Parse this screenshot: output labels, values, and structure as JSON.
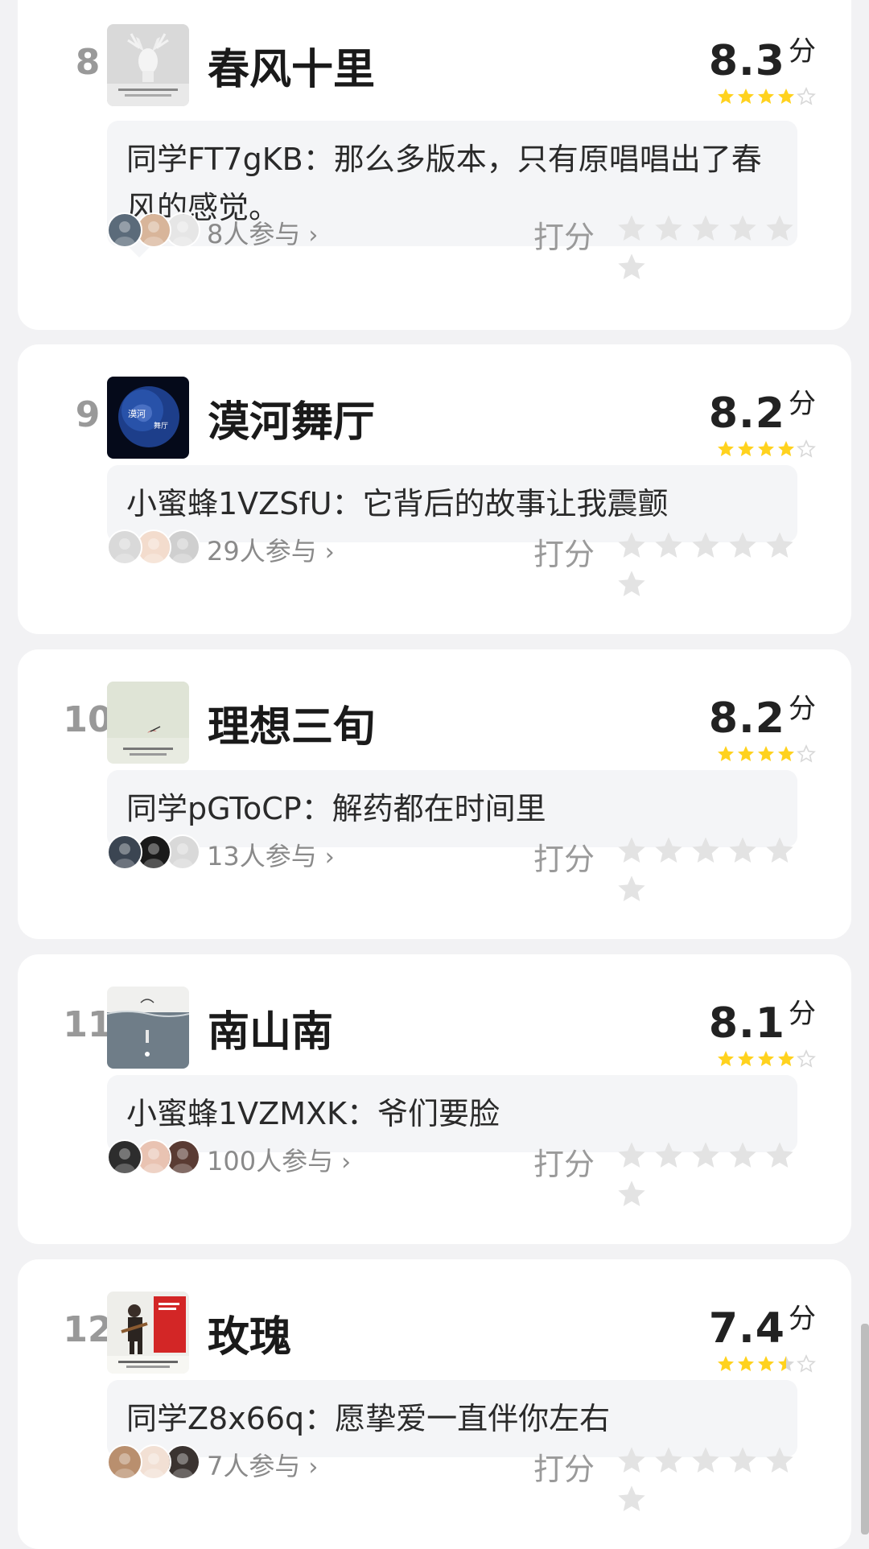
{
  "items": [
    {
      "rank": "8",
      "title": "春风十里",
      "score": "8.3",
      "score_unit": "分",
      "stars_value": 4,
      "cover_icon": "deer-head-icon",
      "comment": "同学FT7gKB：那么多版本，只有原唱唱出了春风的感觉。",
      "participants": "8人参与",
      "rate_label": "打分"
    },
    {
      "rank": "9",
      "title": "漠河舞厅",
      "score": "8.2",
      "score_unit": "分",
      "stars_value": 4,
      "cover_icon": "earth-icon",
      "comment": "小蜜蜂1VZSfU：它背后的故事让我震颤",
      "participants": "29人参与",
      "rate_label": "打分"
    },
    {
      "rank": "10",
      "title": "理想三旬",
      "score": "8.2",
      "score_unit": "分",
      "stars_value": 4,
      "cover_icon": "bird-icon",
      "comment": "同学pGToCP：解药都在时间里",
      "participants": "13人参与",
      "rate_label": "打分"
    },
    {
      "rank": "11",
      "title": "南山南",
      "score": "8.1",
      "score_unit": "分",
      "stars_value": 4,
      "cover_icon": "sea-icon",
      "comment": "小蜜蜂1VZMXK：爷们要脸",
      "participants": "100人参与",
      "rate_label": "打分"
    },
    {
      "rank": "12",
      "title": "玫瑰",
      "score": "7.4",
      "score_unit": "分",
      "stars_value": 3.5,
      "cover_icon": "guitarist-icon",
      "comment": "同学Z8x66q：愿挚爱一直伴你左右",
      "participants": "7人参与",
      "rate_label": "打分"
    }
  ],
  "colors": {
    "star_filled": "#ffd21e",
    "star_empty": "#d8d8d8",
    "rate_star": "#e3e3e3",
    "background": "#f2f2f4",
    "card": "#ffffff"
  },
  "icons": {
    "chevron": "chevron-right-icon",
    "mini_star": "star-icon",
    "rate_star": "star-outline-icon"
  }
}
